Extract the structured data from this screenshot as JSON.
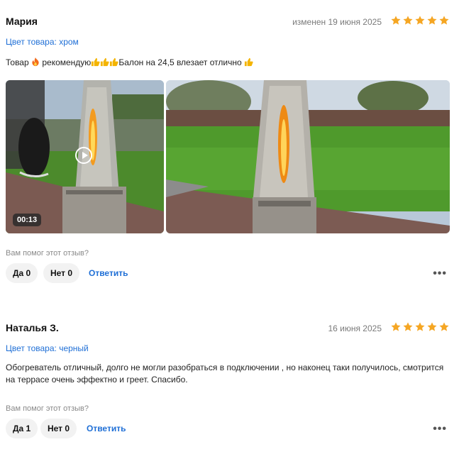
{
  "reviews": [
    {
      "author": "Мария",
      "date": "изменен 19 июня 2025",
      "rating": 5,
      "color_line": "Цвет товара: хром",
      "text_parts": [
        "Товар",
        "рекомендую",
        "Балон на 24,5 влезает отлично"
      ],
      "video_duration": "00:13",
      "helpful_prompt": "Вам помог этот отзыв?",
      "yes_label": "Да 0",
      "no_label": "Нет 0",
      "reply_label": "Ответить",
      "more_label": "•••"
    },
    {
      "author": "Наталья З.",
      "date": "16 июня 2025",
      "rating": 5,
      "color_line": "Цвет товара: черный",
      "text": "Обогреватель отличный, долго не могли разобраться в подключении , но наконец таки получилось, смотрится на террасе очень эффектно и греет. Спасибо.",
      "helpful_prompt": "Вам помог этот отзыв?",
      "yes_label": "Да 1",
      "no_label": "Нет 0",
      "reply_label": "Ответить",
      "more_label": "•••"
    }
  ],
  "colors": {
    "star": "#f5a623",
    "link": "#1f6fd6",
    "muted": "#7a7a7a",
    "pill_bg": "#f2f2f2"
  },
  "icons": [
    "star-icon",
    "fire-emoji",
    "thumbs-up-emoji",
    "play-icon",
    "more-dots-icon"
  ]
}
